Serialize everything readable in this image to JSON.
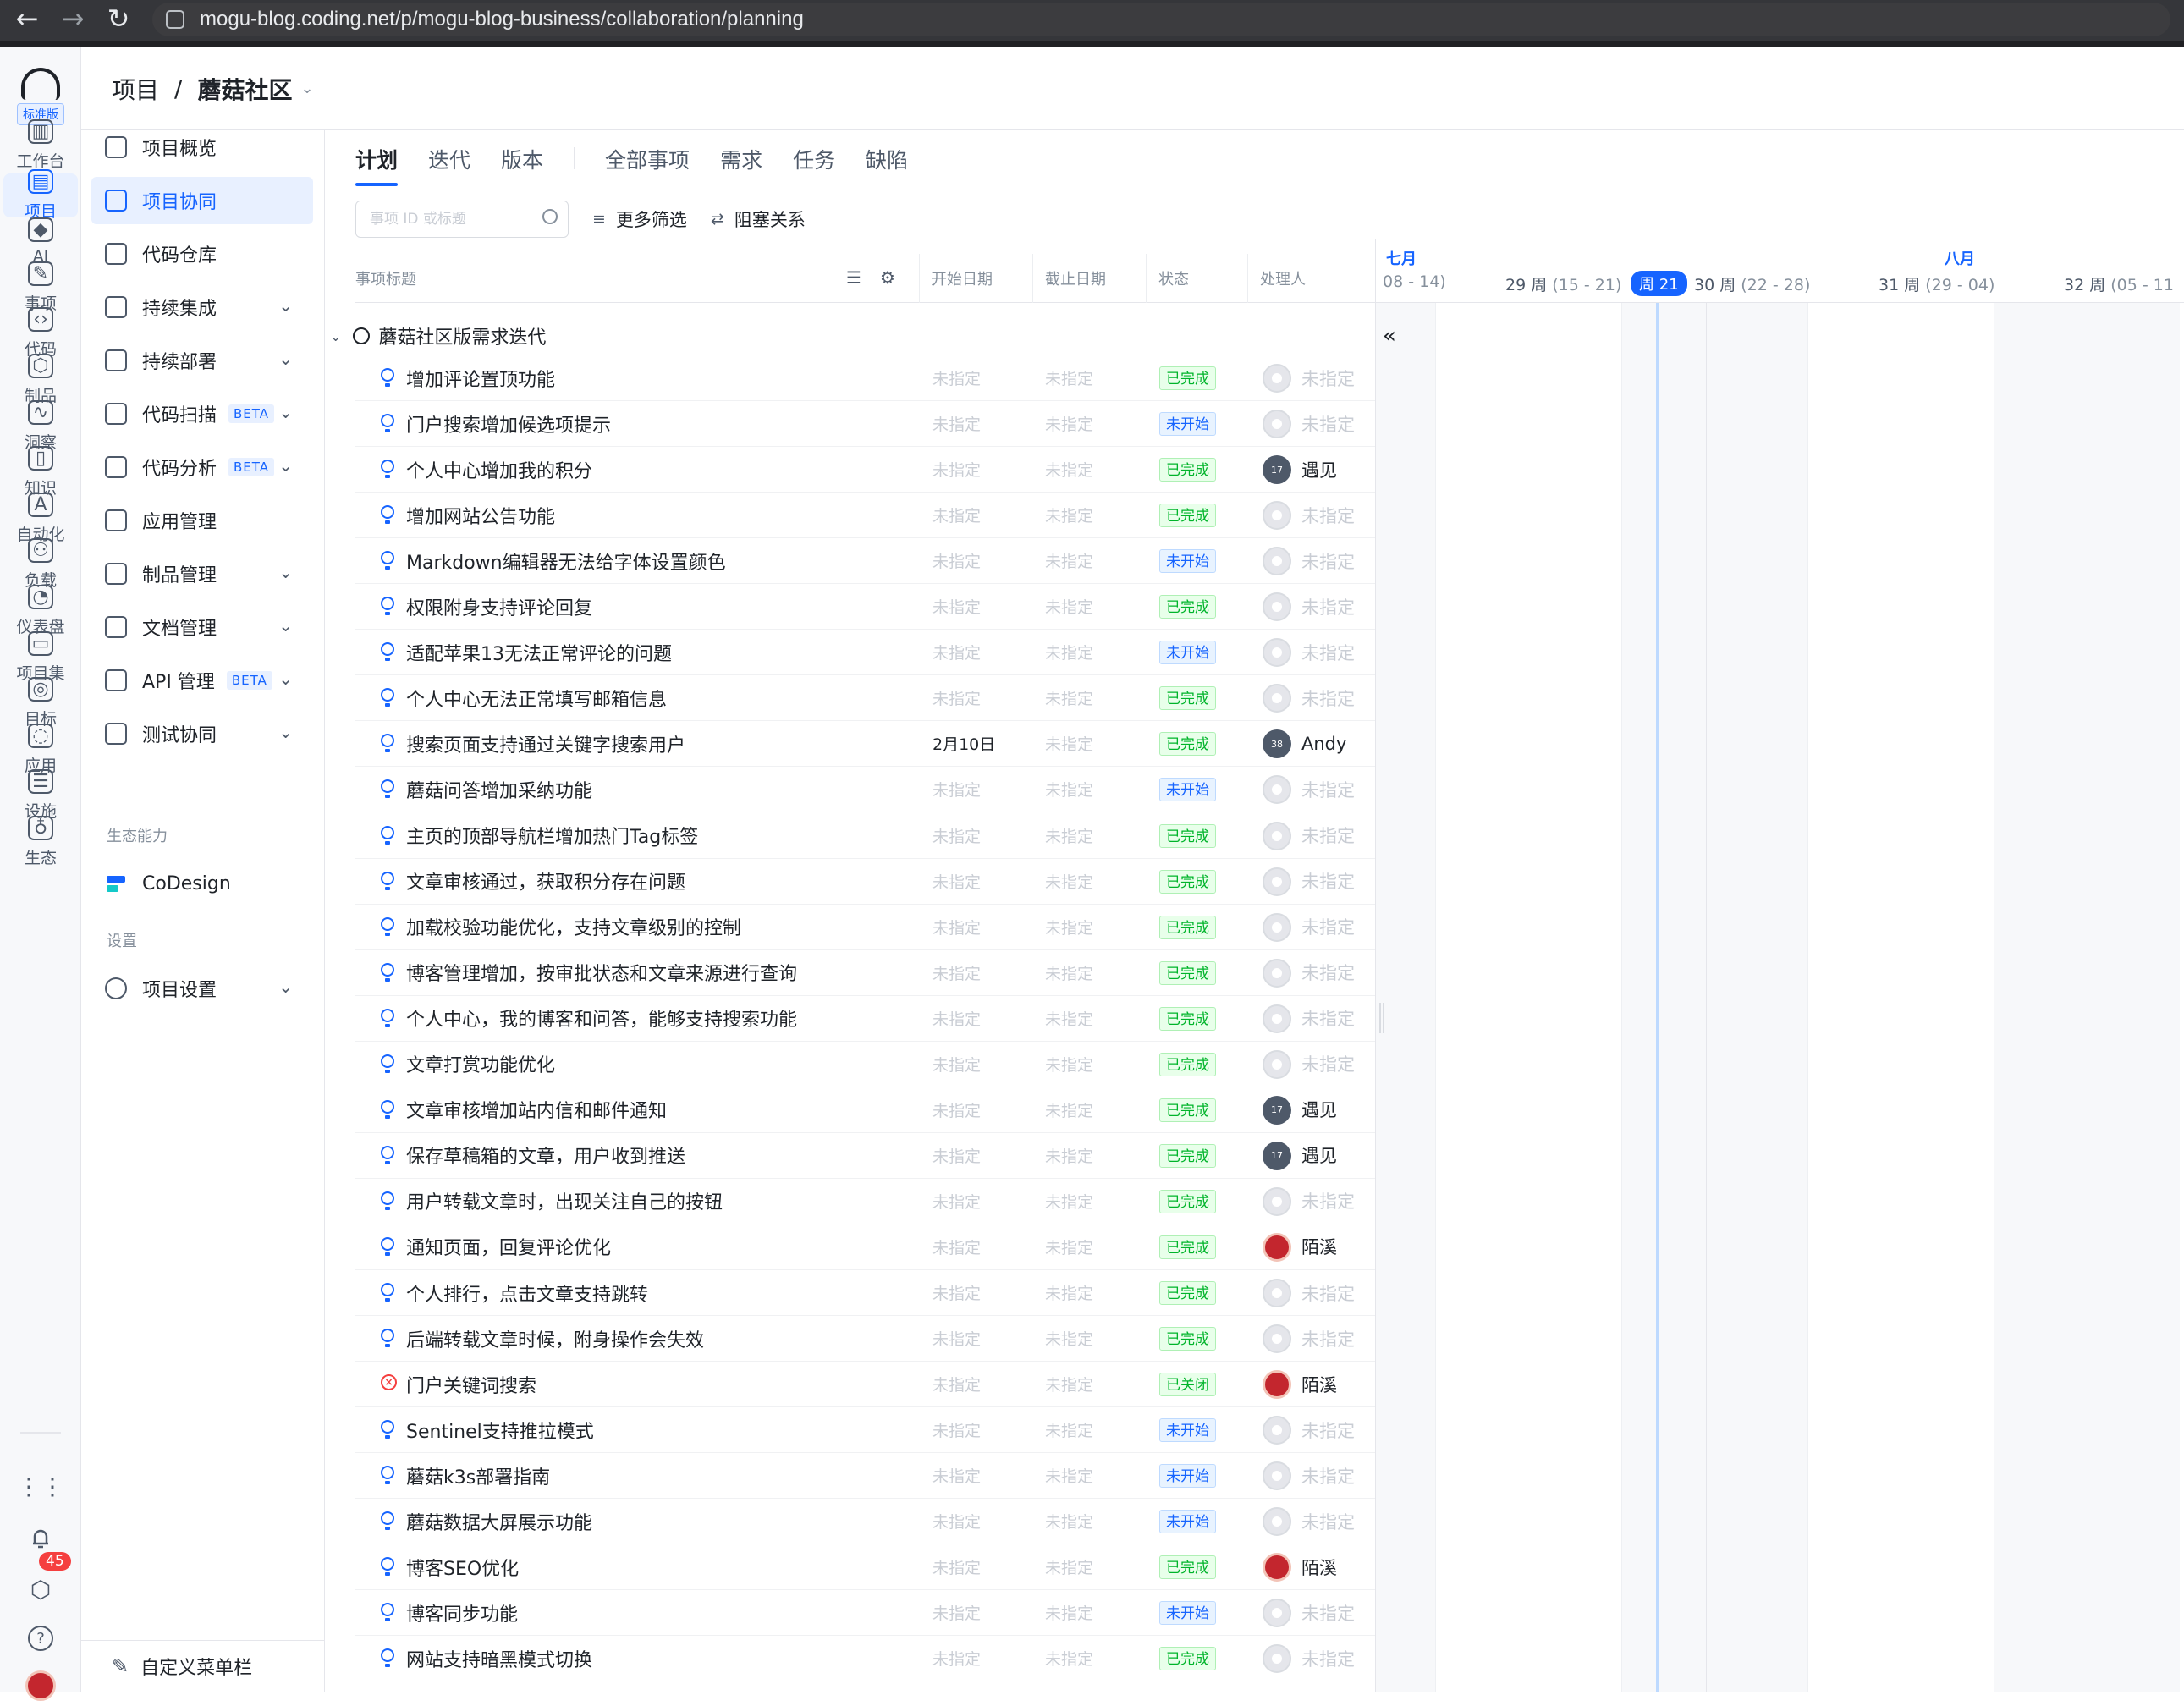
{
  "browser": {
    "url": "mogu-blog.coding.net/p/mogu-blog-business/collaboration/planning",
    "back": "←",
    "forward": "→",
    "reload": "↻"
  },
  "rail": {
    "badge": "标准版",
    "items": [
      {
        "label": "工作台",
        "glyph": "▥"
      },
      {
        "label": "项目",
        "glyph": "▤"
      },
      {
        "label": "AI",
        "glyph": "◆"
      },
      {
        "label": "事项",
        "glyph": "✎"
      },
      {
        "label": "代码",
        "glyph": "‹›"
      },
      {
        "label": "制品",
        "glyph": "⬡"
      },
      {
        "label": "洞察",
        "glyph": "∿"
      },
      {
        "label": "知识",
        "glyph": "▯"
      },
      {
        "label": "自动化",
        "glyph": "A"
      },
      {
        "label": "负载",
        "glyph": "⚇"
      },
      {
        "label": "仪表盘",
        "glyph": "◔"
      },
      {
        "label": "项目集",
        "glyph": "▭"
      },
      {
        "label": "目标",
        "glyph": "◎"
      },
      {
        "label": "应用",
        "glyph": "◌"
      },
      {
        "label": "设施",
        "glyph": "☰"
      },
      {
        "label": "生态",
        "glyph": "♁"
      }
    ],
    "apps_glyph": "⋮⋮",
    "notification_count": "45",
    "bell_glyph": "🔔",
    "settings_glyph": "⬡",
    "help_glyph": "?"
  },
  "header": {
    "root": "项目",
    "sep": "/",
    "project": "蘑菇社区",
    "caret": "⌄"
  },
  "sidebar": {
    "items": [
      {
        "label": "项目概览"
      },
      {
        "label": "项目协同"
      },
      {
        "label": "代码仓库"
      },
      {
        "label": "持续集成",
        "chev": "⌄"
      },
      {
        "label": "持续部署",
        "chev": "⌄"
      },
      {
        "label": "代码扫描",
        "beta": "BETA",
        "chev": "⌄"
      },
      {
        "label": "代码分析",
        "beta": "BETA",
        "chev": "⌄"
      },
      {
        "label": "应用管理"
      },
      {
        "label": "制品管理",
        "chev": "⌄"
      },
      {
        "label": "文档管理",
        "chev": "⌄"
      },
      {
        "label": "API 管理",
        "beta": "BETA",
        "chev": "⌄"
      },
      {
        "label": "测试协同",
        "chev": "⌄"
      }
    ],
    "eco_section": "生态能力",
    "codesign": "CoDesign",
    "settings_section": "设置",
    "project_settings": "项目设置",
    "project_settings_chev": "⌄",
    "customize": "自定义菜单栏"
  },
  "tabs": {
    "plan": "计划",
    "iteration": "迭代",
    "version": "版本",
    "all": "全部事项",
    "requirement": "需求",
    "task": "任务",
    "defect": "缺陷"
  },
  "filter": {
    "search_placeholder": "事项 ID 或标题",
    "more_filters": "更多筛选",
    "blocking": "阻塞关系",
    "filter_glyph": "≡",
    "block_glyph": "⇄"
  },
  "table": {
    "headers": {
      "title": "事项标题",
      "start": "开始日期",
      "end": "截止日期",
      "status": "状态",
      "assignee": "处理人"
    },
    "tools": {
      "sort": "☰",
      "gear": "⚙"
    },
    "group": {
      "caret": "⌄",
      "name": "蘑菇社区版需求迭代"
    },
    "rows": [
      {
        "type": "req",
        "title": "增加评论置顶功能",
        "start": "未指定",
        "end": "未指定",
        "status": "已完成",
        "st": "done",
        "avatar": "empty",
        "avatar_text": "",
        "assignee": "未指定"
      },
      {
        "type": "req",
        "title": "门户搜索增加候选项提示",
        "start": "未指定",
        "end": "未指定",
        "status": "未开始",
        "st": "todo",
        "avatar": "empty",
        "avatar_text": "",
        "assignee": "未指定"
      },
      {
        "type": "req",
        "title": "个人中心增加我的积分",
        "start": "未指定",
        "end": "未指定",
        "status": "已完成",
        "st": "done",
        "avatar": "num",
        "avatar_text": "17",
        "assignee": "遇见"
      },
      {
        "type": "req",
        "title": "增加网站公告功能",
        "start": "未指定",
        "end": "未指定",
        "status": "已完成",
        "st": "done",
        "avatar": "empty",
        "avatar_text": "",
        "assignee": "未指定"
      },
      {
        "type": "req",
        "title": "Markdown编辑器无法给字体设置颜色",
        "start": "未指定",
        "end": "未指定",
        "status": "未开始",
        "st": "todo",
        "avatar": "empty",
        "avatar_text": "",
        "assignee": "未指定"
      },
      {
        "type": "req",
        "title": "权限附身支持评论回复",
        "start": "未指定",
        "end": "未指定",
        "status": "已完成",
        "st": "done",
        "avatar": "empty",
        "avatar_text": "",
        "assignee": "未指定"
      },
      {
        "type": "req",
        "title": "适配苹果13无法正常评论的问题",
        "start": "未指定",
        "end": "未指定",
        "status": "未开始",
        "st": "todo",
        "avatar": "empty",
        "avatar_text": "",
        "assignee": "未指定"
      },
      {
        "type": "req",
        "title": "个人中心无法正常填写邮箱信息",
        "start": "未指定",
        "end": "未指定",
        "status": "已完成",
        "st": "done",
        "avatar": "empty",
        "avatar_text": "",
        "assignee": "未指定"
      },
      {
        "type": "req",
        "title": "搜索页面支持通过关键字搜索用户",
        "start": "2月10日",
        "end": "未指定",
        "status": "已完成",
        "st": "done",
        "avatar": "num",
        "avatar_text": "38",
        "assignee": "Andy",
        "start_set": true
      },
      {
        "type": "req",
        "title": "蘑菇问答增加采纳功能",
        "start": "未指定",
        "end": "未指定",
        "status": "未开始",
        "st": "todo",
        "avatar": "empty",
        "avatar_text": "",
        "assignee": "未指定"
      },
      {
        "type": "req",
        "title": "主页的顶部导航栏增加热门Tag标签",
        "start": "未指定",
        "end": "未指定",
        "status": "已完成",
        "st": "done",
        "avatar": "empty",
        "avatar_text": "",
        "assignee": "未指定"
      },
      {
        "type": "req",
        "title": "文章审核通过，获取积分存在问题",
        "start": "未指定",
        "end": "未指定",
        "status": "已完成",
        "st": "done",
        "avatar": "empty",
        "avatar_text": "",
        "assignee": "未指定"
      },
      {
        "type": "req",
        "title": "加载校验功能优化，支持文章级别的控制",
        "start": "未指定",
        "end": "未指定",
        "status": "已完成",
        "st": "done",
        "avatar": "empty",
        "avatar_text": "",
        "assignee": "未指定"
      },
      {
        "type": "req",
        "title": "博客管理增加，按审批状态和文章来源进行查询",
        "start": "未指定",
        "end": "未指定",
        "status": "已完成",
        "st": "done",
        "avatar": "empty",
        "avatar_text": "",
        "assignee": "未指定"
      },
      {
        "type": "req",
        "title": "个人中心，我的博客和问答，能够支持搜索功能",
        "start": "未指定",
        "end": "未指定",
        "status": "已完成",
        "st": "done",
        "avatar": "empty",
        "avatar_text": "",
        "assignee": "未指定"
      },
      {
        "type": "req",
        "title": "文章打赏功能优化",
        "start": "未指定",
        "end": "未指定",
        "status": "已完成",
        "st": "done",
        "avatar": "empty",
        "avatar_text": "",
        "assignee": "未指定"
      },
      {
        "type": "req",
        "title": "文章审核增加站内信和邮件通知",
        "start": "未指定",
        "end": "未指定",
        "status": "已完成",
        "st": "done",
        "avatar": "num",
        "avatar_text": "17",
        "assignee": "遇见"
      },
      {
        "type": "req",
        "title": "保存草稿箱的文章，用户收到推送",
        "start": "未指定",
        "end": "未指定",
        "status": "已完成",
        "st": "done",
        "avatar": "num",
        "avatar_text": "17",
        "assignee": "遇见"
      },
      {
        "type": "req",
        "title": "用户转载文章时，出现关注自己的按钮",
        "start": "未指定",
        "end": "未指定",
        "status": "已完成",
        "st": "done",
        "avatar": "empty",
        "avatar_text": "",
        "assignee": "未指定"
      },
      {
        "type": "req",
        "title": "通知页面，回复评论优化",
        "start": "未指定",
        "end": "未指定",
        "status": "已完成",
        "st": "done",
        "avatar": "red",
        "avatar_text": "",
        "assignee": "陌溪"
      },
      {
        "type": "req",
        "title": "个人排行，点击文章支持跳转",
        "start": "未指定",
        "end": "未指定",
        "status": "已完成",
        "st": "done",
        "avatar": "empty",
        "avatar_text": "",
        "assignee": "未指定"
      },
      {
        "type": "req",
        "title": "后端转载文章时候，附身操作会失效",
        "start": "未指定",
        "end": "未指定",
        "status": "已完成",
        "st": "done",
        "avatar": "empty",
        "avatar_text": "",
        "assignee": "未指定"
      },
      {
        "type": "defect",
        "title": "门户关键词搜索",
        "start": "未指定",
        "end": "未指定",
        "status": "已关闭",
        "st": "closed",
        "avatar": "red",
        "avatar_text": "",
        "assignee": "陌溪"
      },
      {
        "type": "req",
        "title": "Sentinel支持推拉模式",
        "start": "未指定",
        "end": "未指定",
        "status": "未开始",
        "st": "todo",
        "avatar": "empty",
        "avatar_text": "",
        "assignee": "未指定"
      },
      {
        "type": "req",
        "title": "蘑菇k3s部署指南",
        "start": "未指定",
        "end": "未指定",
        "status": "未开始",
        "st": "todo",
        "avatar": "empty",
        "avatar_text": "",
        "assignee": "未指定"
      },
      {
        "type": "req",
        "title": "蘑菇数据大屏展示功能",
        "start": "未指定",
        "end": "未指定",
        "status": "未开始",
        "st": "todo",
        "avatar": "empty",
        "avatar_text": "",
        "assignee": "未指定"
      },
      {
        "type": "req",
        "title": "博客SEO优化",
        "start": "未指定",
        "end": "未指定",
        "status": "已完成",
        "st": "done",
        "avatar": "red",
        "avatar_text": "",
        "assignee": "陌溪"
      },
      {
        "type": "req",
        "title": "博客同步功能",
        "start": "未指定",
        "end": "未指定",
        "status": "未开始",
        "st": "todo",
        "avatar": "empty",
        "avatar_text": "",
        "assignee": "未指定"
      },
      {
        "type": "req",
        "title": "网站支持暗黑模式切换",
        "start": "未指定",
        "end": "未指定",
        "status": "已完成",
        "st": "done",
        "avatar": "empty",
        "avatar_text": "",
        "assignee": "未指定"
      }
    ]
  },
  "gantt": {
    "month_july": "七月",
    "month_august": "八月",
    "weeks": [
      {
        "label": "",
        "range": "08 - 14)"
      },
      {
        "label": "29 周",
        "range": "(15 - 21)"
      },
      {
        "label": "30 周",
        "range": "(22 - 28)"
      },
      {
        "label": "31 周",
        "range": "(29 - 04)"
      },
      {
        "label": "32 周",
        "range": "(05 - 11"
      }
    ],
    "today": "周 21",
    "collapse": "«"
  }
}
